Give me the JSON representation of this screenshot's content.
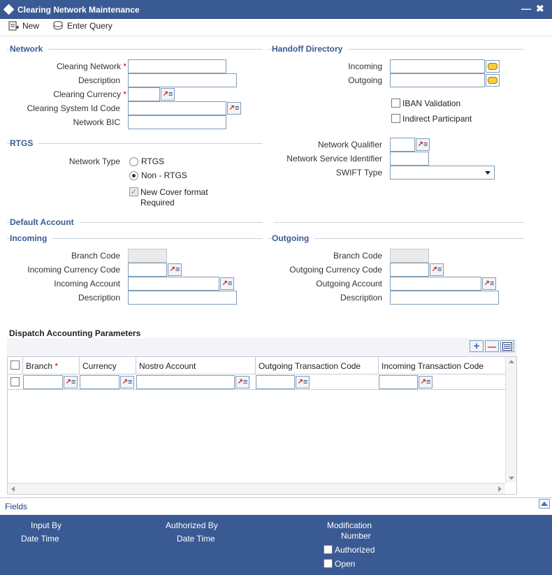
{
  "window": {
    "title": "Clearing Network Maintenance",
    "minimize": "—",
    "close": "✖"
  },
  "toolbar": {
    "new_label": "New",
    "enter_query_label": "Enter Query"
  },
  "network": {
    "heading": "Network",
    "clearing_network_label": "Clearing Network",
    "clearing_network_value": "",
    "description_label": "Description",
    "description_value": "",
    "clearing_currency_label": "Clearing Currency",
    "clearing_currency_value": "",
    "clearing_system_id_label": "Clearing System Id Code",
    "clearing_system_id_value": "",
    "network_bic_label": "Network BIC",
    "network_bic_value": "",
    "required_mark": "*"
  },
  "handoff": {
    "heading": "Handoff Directory",
    "incoming_label": "Incoming",
    "incoming_value": "",
    "outgoing_label": "Outgoing",
    "outgoing_value": "",
    "iban_label": "IBAN Validation",
    "indirect_label": "Indirect Participant"
  },
  "rtgs": {
    "heading": "RTGS",
    "network_type_label": "Network Type",
    "option_rtgs": "RTGS",
    "option_non_rtgs": "Non - RTGS",
    "new_cover_line1": "New Cover format",
    "new_cover_line2": "Required",
    "network_qualifier_label": "Network Qualifier",
    "network_qualifier_value": "",
    "network_service_label": "Network Service Identifier",
    "network_service_value": "",
    "swift_type_label": "SWIFT Type",
    "swift_type_value": ""
  },
  "default_account": {
    "heading": "Default Account",
    "incoming": {
      "heading": "Incoming",
      "branch_label": "Branch Code",
      "currency_label": "Incoming Currency Code",
      "account_label": "Incoming Account",
      "description_label": "Description"
    },
    "outgoing": {
      "heading": "Outgoing",
      "branch_label": "Branch Code",
      "currency_label": "Outgoing Currency Code",
      "account_label": "Outgoing Account",
      "description_label": "Description"
    }
  },
  "dispatch": {
    "heading": "Dispatch Accounting Parameters",
    "add": "+",
    "remove": "—",
    "columns": [
      "Branch",
      "Currency",
      "Nostro Account",
      "Outgoing Transaction Code",
      "Incoming Transaction Code"
    ],
    "branch_required": "*"
  },
  "footer": {
    "fields_label": "Fields",
    "input_by": "Input By",
    "date_time": "Date Time",
    "authorized_by": "Authorized By",
    "date_time2": "Date Time",
    "modification_line1": "Modification",
    "modification_line2": "Number",
    "authorized_label": "Authorized",
    "open_label": "Open"
  }
}
